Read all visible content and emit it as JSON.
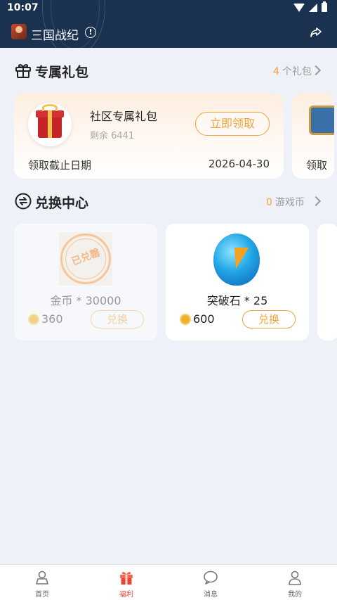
{
  "status_bar": {
    "time": "10:07"
  },
  "header": {
    "title": "三国战纪",
    "info_glyph": "!"
  },
  "gifts_section": {
    "title": "专属礼包",
    "count": "4",
    "count_suffix": "个礼包",
    "cards": [
      {
        "name": "社区专属礼包",
        "remaining": "剩余 6441",
        "button": "立即领取",
        "deadline_label": "领取截止日期",
        "deadline_date": "2026-04-30"
      },
      {
        "deadline_label": "领取"
      }
    ]
  },
  "exchange_section": {
    "title": "兑换中心",
    "coins": "0",
    "coins_suffix": "游戏币",
    "items": [
      {
        "name": "金币 * 30000",
        "price": "360",
        "button": "兑换",
        "stamp": "已兑罄",
        "redeemed": true
      },
      {
        "name": "突破石 * 25",
        "price": "600",
        "button": "兑换",
        "redeemed": false
      }
    ]
  },
  "bottom_nav": {
    "items": [
      {
        "label": "首页",
        "icon": "home-icon"
      },
      {
        "label": "福利",
        "icon": "gift-icon",
        "active": true
      },
      {
        "label": "消息",
        "icon": "chat-icon"
      },
      {
        "label": "我的",
        "icon": "user-icon"
      }
    ]
  },
  "colors": {
    "header_bg": "#1b3150",
    "accent": "#f0a43a",
    "active_nav": "#e8443a",
    "page_bg": "#eef1f7"
  }
}
